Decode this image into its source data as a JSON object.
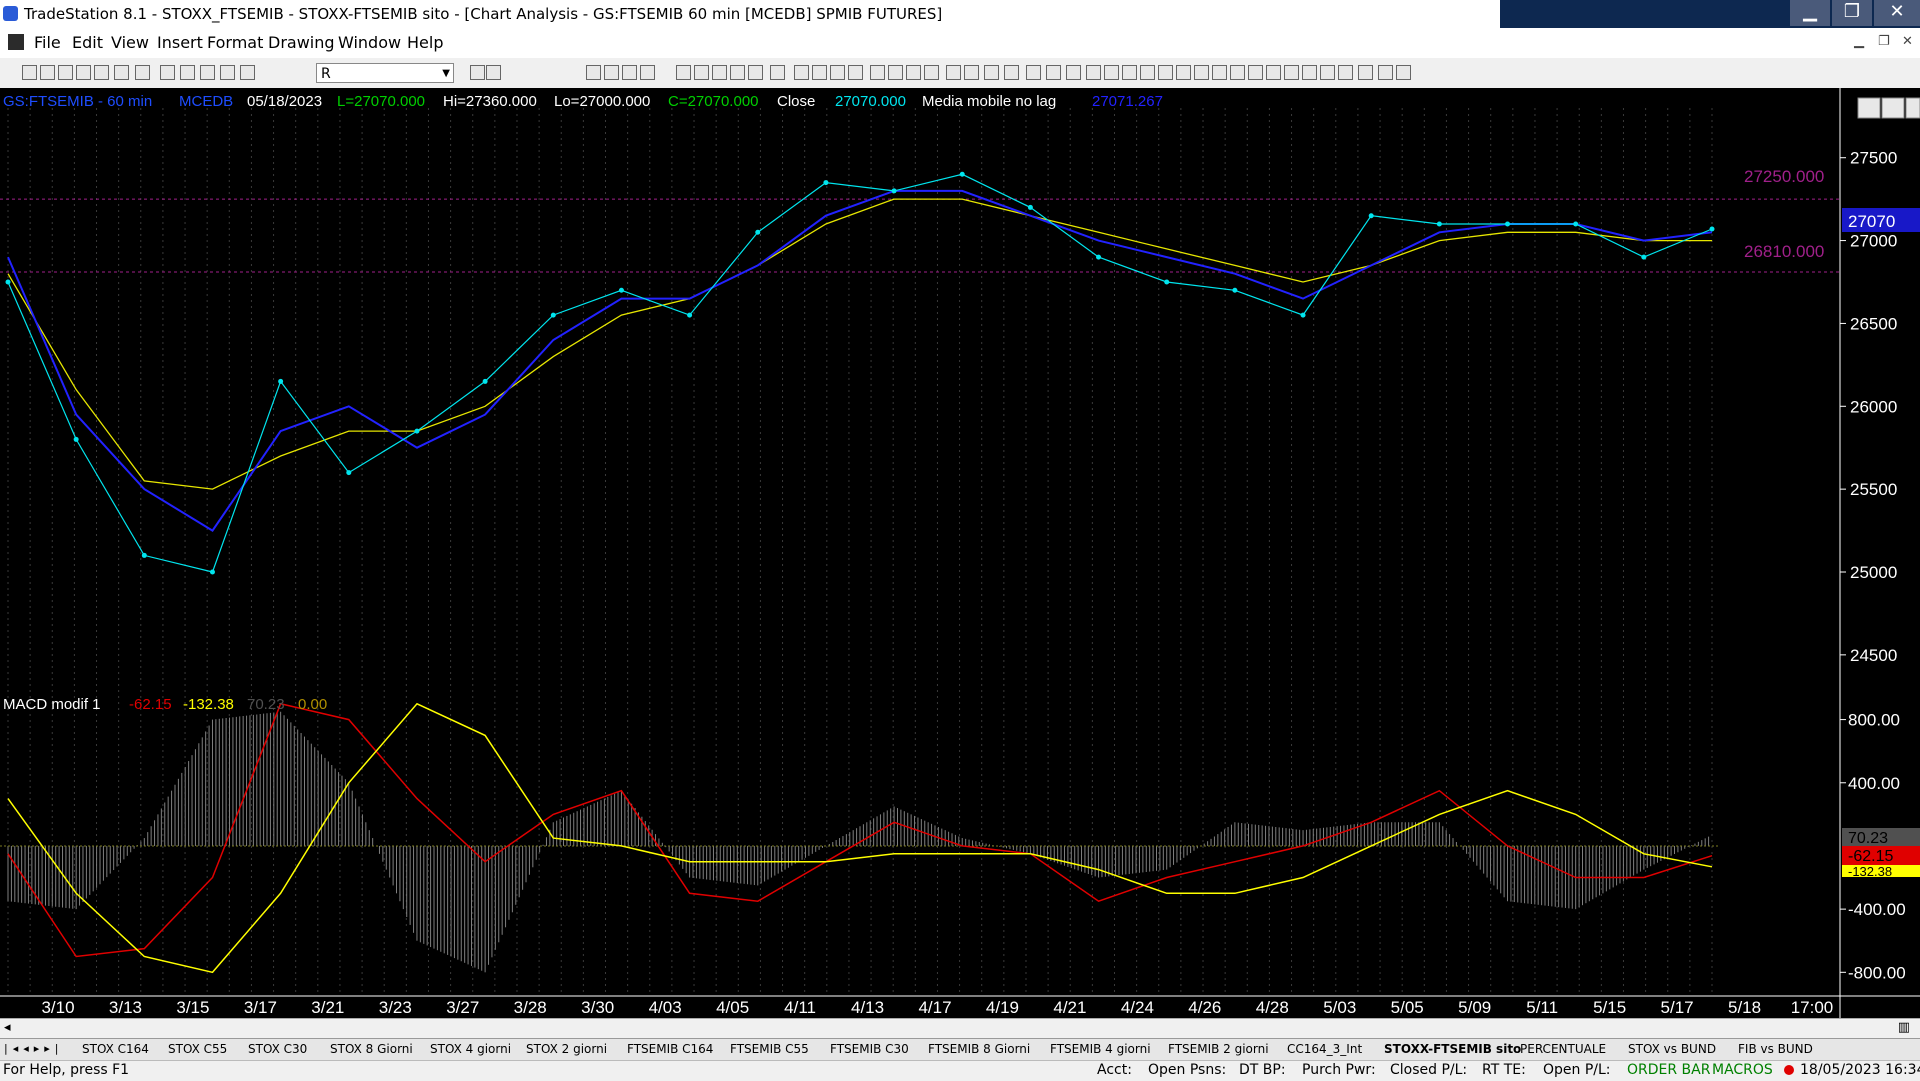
{
  "window": {
    "title": "TradeStation 8.1 - STOXX_FTSEMIB - STOXX-FTSEMIB sito - [Chart Analysis - GS:FTSEMIB  60 min  [MCEDB] SPMIB FUTURES]",
    "controls": [
      "▁",
      "❐",
      "✕"
    ]
  },
  "menu": [
    "File",
    "Edit",
    "View",
    "Insert",
    "Format",
    "Drawing",
    "Window",
    "Help"
  ],
  "symbol_box": "R",
  "chart_header": {
    "symbol": "GS:FTSEMIB - 60 min",
    "session": "MCEDB",
    "date": "05/18/2023",
    "low_label": "L=27070.000",
    "hi": "Hi=27360.000",
    "lo": "Lo=27000.000",
    "close_label": "C=27070.000",
    "close_word": "Close",
    "close_value": "27070.000",
    "indicator": "Media mobile no lag",
    "indicator_value": "27071.267"
  },
  "macd_header": {
    "name": "MACD modif 1",
    "v1": "-62.15",
    "v2": "-132.38",
    "v3": "70.23",
    "v4": "0.00"
  },
  "price_axis": [
    "27500",
    "27000",
    "26500",
    "26000",
    "25500",
    "25000",
    "24500"
  ],
  "macd_axis": [
    "800.00",
    "400.00",
    "-400.00",
    "-800.00"
  ],
  "level_labels": {
    "upper": "27250.000",
    "lower": "26810.000",
    "last": "27070"
  },
  "macd_tags": {
    "hist": "70.23",
    "macd": "-62.15",
    "signal": "-132.38"
  },
  "x_labels": [
    "3/10",
    "3/13",
    "3/15",
    "3/17",
    "3/21",
    "3/23",
    "3/27",
    "3/28",
    "3/30",
    "4/03",
    "4/05",
    "4/11",
    "4/13",
    "4/17",
    "4/19",
    "4/21",
    "4/24",
    "4/26",
    "4/28",
    "5/03",
    "5/05",
    "5/09",
    "5/11",
    "5/15",
    "5/17",
    "5/18",
    "17:00"
  ],
  "colors": {
    "price": "#00e5ee",
    "ma_blue": "#2222ff",
    "ma_yellow": "#e6e600",
    "macd_red": "#e00000",
    "signal_yellow": "#ffff00",
    "hist_gray": "#808080",
    "level_magenta": "#a0208a"
  },
  "chart_data": [
    {
      "type": "line",
      "title": "GS:FTSEMIB - 60 min",
      "xlabel": "",
      "ylabel": "",
      "ylim": [
        24300,
        27800
      ],
      "x": [
        "3/10",
        "3/13",
        "3/15",
        "3/17",
        "3/21",
        "3/23",
        "3/27",
        "3/28",
        "3/30",
        "4/03",
        "4/05",
        "4/11",
        "4/13",
        "4/17",
        "4/19",
        "4/21",
        "4/24",
        "4/26",
        "4/28",
        "5/03",
        "5/05",
        "5/09",
        "5/11",
        "5/15",
        "5/17",
        "5/18"
      ],
      "series": [
        {
          "values": [
            26750,
            25800,
            25100,
            25000,
            26150,
            25600,
            25850,
            26150,
            26550,
            26700,
            26550,
            27050,
            27350,
            27300,
            27400,
            27200,
            26900,
            26750,
            26700,
            26550,
            27150,
            27100,
            27100,
            27100,
            26900,
            27070
          ]
        },
        {
          "values": [
            26900,
            25950,
            25500,
            25250,
            25850,
            26000,
            25750,
            25950,
            26400,
            26650,
            26650,
            26850,
            27150,
            27300,
            27300,
            27150,
            27000,
            26900,
            26800,
            26650,
            26850,
            27050,
            27100,
            27100,
            27000,
            27050
          ]
        },
        {
          "values": [
            26800,
            26100,
            25550,
            25500,
            25700,
            25850,
            25850,
            26000,
            26300,
            26550,
            26650,
            26850,
            27100,
            27250,
            27250,
            27150,
            27050,
            26950,
            26850,
            26750,
            26850,
            27000,
            27050,
            27050,
            27000,
            27000
          ]
        }
      ],
      "levels": [
        27250,
        26810
      ],
      "last": 27070
    },
    {
      "type": "line",
      "title": "MACD modif 1",
      "ylim": [
        -950,
        1000
      ],
      "x": [
        "3/10",
        "3/13",
        "3/15",
        "3/17",
        "3/21",
        "3/23",
        "3/27",
        "3/28",
        "3/30",
        "4/03",
        "4/05",
        "4/11",
        "4/13",
        "4/17",
        "4/19",
        "4/21",
        "4/24",
        "4/26",
        "4/28",
        "5/03",
        "5/05",
        "5/09",
        "5/11",
        "5/15",
        "5/17",
        "5/18"
      ],
      "series": [
        {
          "values": [
            -50,
            -700,
            -650,
            -200,
            900,
            800,
            300,
            -100,
            200,
            350,
            -300,
            -350,
            -100,
            150,
            0,
            -50,
            -350,
            -200,
            -100,
            0,
            150,
            350,
            0,
            -200,
            -200,
            -62
          ]
        },
        {
          "values": [
            300,
            -300,
            -700,
            -800,
            -300,
            400,
            900,
            700,
            50,
            0,
            -100,
            -100,
            -100,
            -50,
            -50,
            -50,
            -150,
            -300,
            -300,
            -200,
            0,
            200,
            350,
            200,
            -50,
            -132
          ]
        },
        {
          "values": [
            -350,
            -400,
            50,
            800,
            850,
            400,
            -600,
            -800,
            150,
            350,
            -200,
            -250,
            0,
            250,
            50,
            -50,
            -200,
            -150,
            150,
            100,
            150,
            150,
            -350,
            -400,
            -150,
            70
          ]
        }
      ]
    }
  ],
  "tabs": [
    "STOX C164",
    "STOX C55",
    "STOX  C30",
    "STOX  8 Giorni",
    "STOX 4 giorni",
    "STOX  2 giorni",
    "FTSEMIB C164",
    "FTSEMIB C55",
    "FTSEMIB C30",
    "FTSEMIB  8 Giorni",
    "FTSEMIB  4 giorni",
    "FTSEMIB  2 giorni",
    "CC164_3_Int",
    "STOXX-FTSEMIB sito",
    "PERCENTUALE",
    "STOX vs BUND",
    "FIB vs BUND"
  ],
  "status": {
    "help": "For Help, press F1",
    "acct": "Acct:",
    "open_psns": "Open Psns:",
    "dt_bp": "DT BP:",
    "purch_pwr": "Purch Pwr:",
    "closed_pl": "Closed P/L:",
    "rt_te": "RT TE:",
    "open_pl": "Open P/L:",
    "order_bar": "ORDER BAR",
    "macros": "MACROS",
    "datetime": "18/05/2023 16:34"
  }
}
